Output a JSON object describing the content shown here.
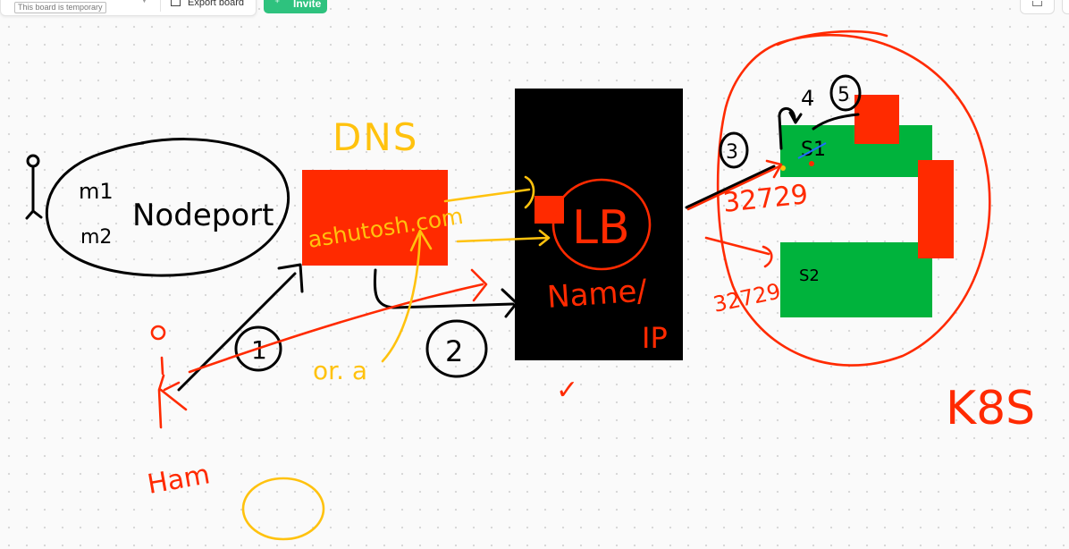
{
  "toolbar": {
    "temp_badge": "This board is temporary",
    "export_label": "Export board",
    "invite_label": "Invite"
  },
  "colors": {
    "red": "#ff2a00",
    "green": "#00b33c",
    "yellow": "#ffc20e",
    "black": "#000000",
    "invite_green": "#2ec27e"
  },
  "board": {
    "nodeport_m1": "m1",
    "nodeport_m2": "m2",
    "nodeport_label": "Nodeport",
    "dns_label": "DNS",
    "dns_box_text": "ashutosh.com",
    "lb_label": "LB",
    "lb_name_label": "Name/",
    "lb_ip_label": "IP",
    "lb_check": "✓",
    "step1": "1",
    "step2": "2",
    "step3": "3",
    "step4": "4",
    "step5": "5",
    "or_a": "or. a",
    "s1_label": "S1",
    "s2_label": "S2",
    "port_s1": "32729",
    "port_s2": "32729",
    "k8s_label": "K8S",
    "human_label": "Ham"
  }
}
